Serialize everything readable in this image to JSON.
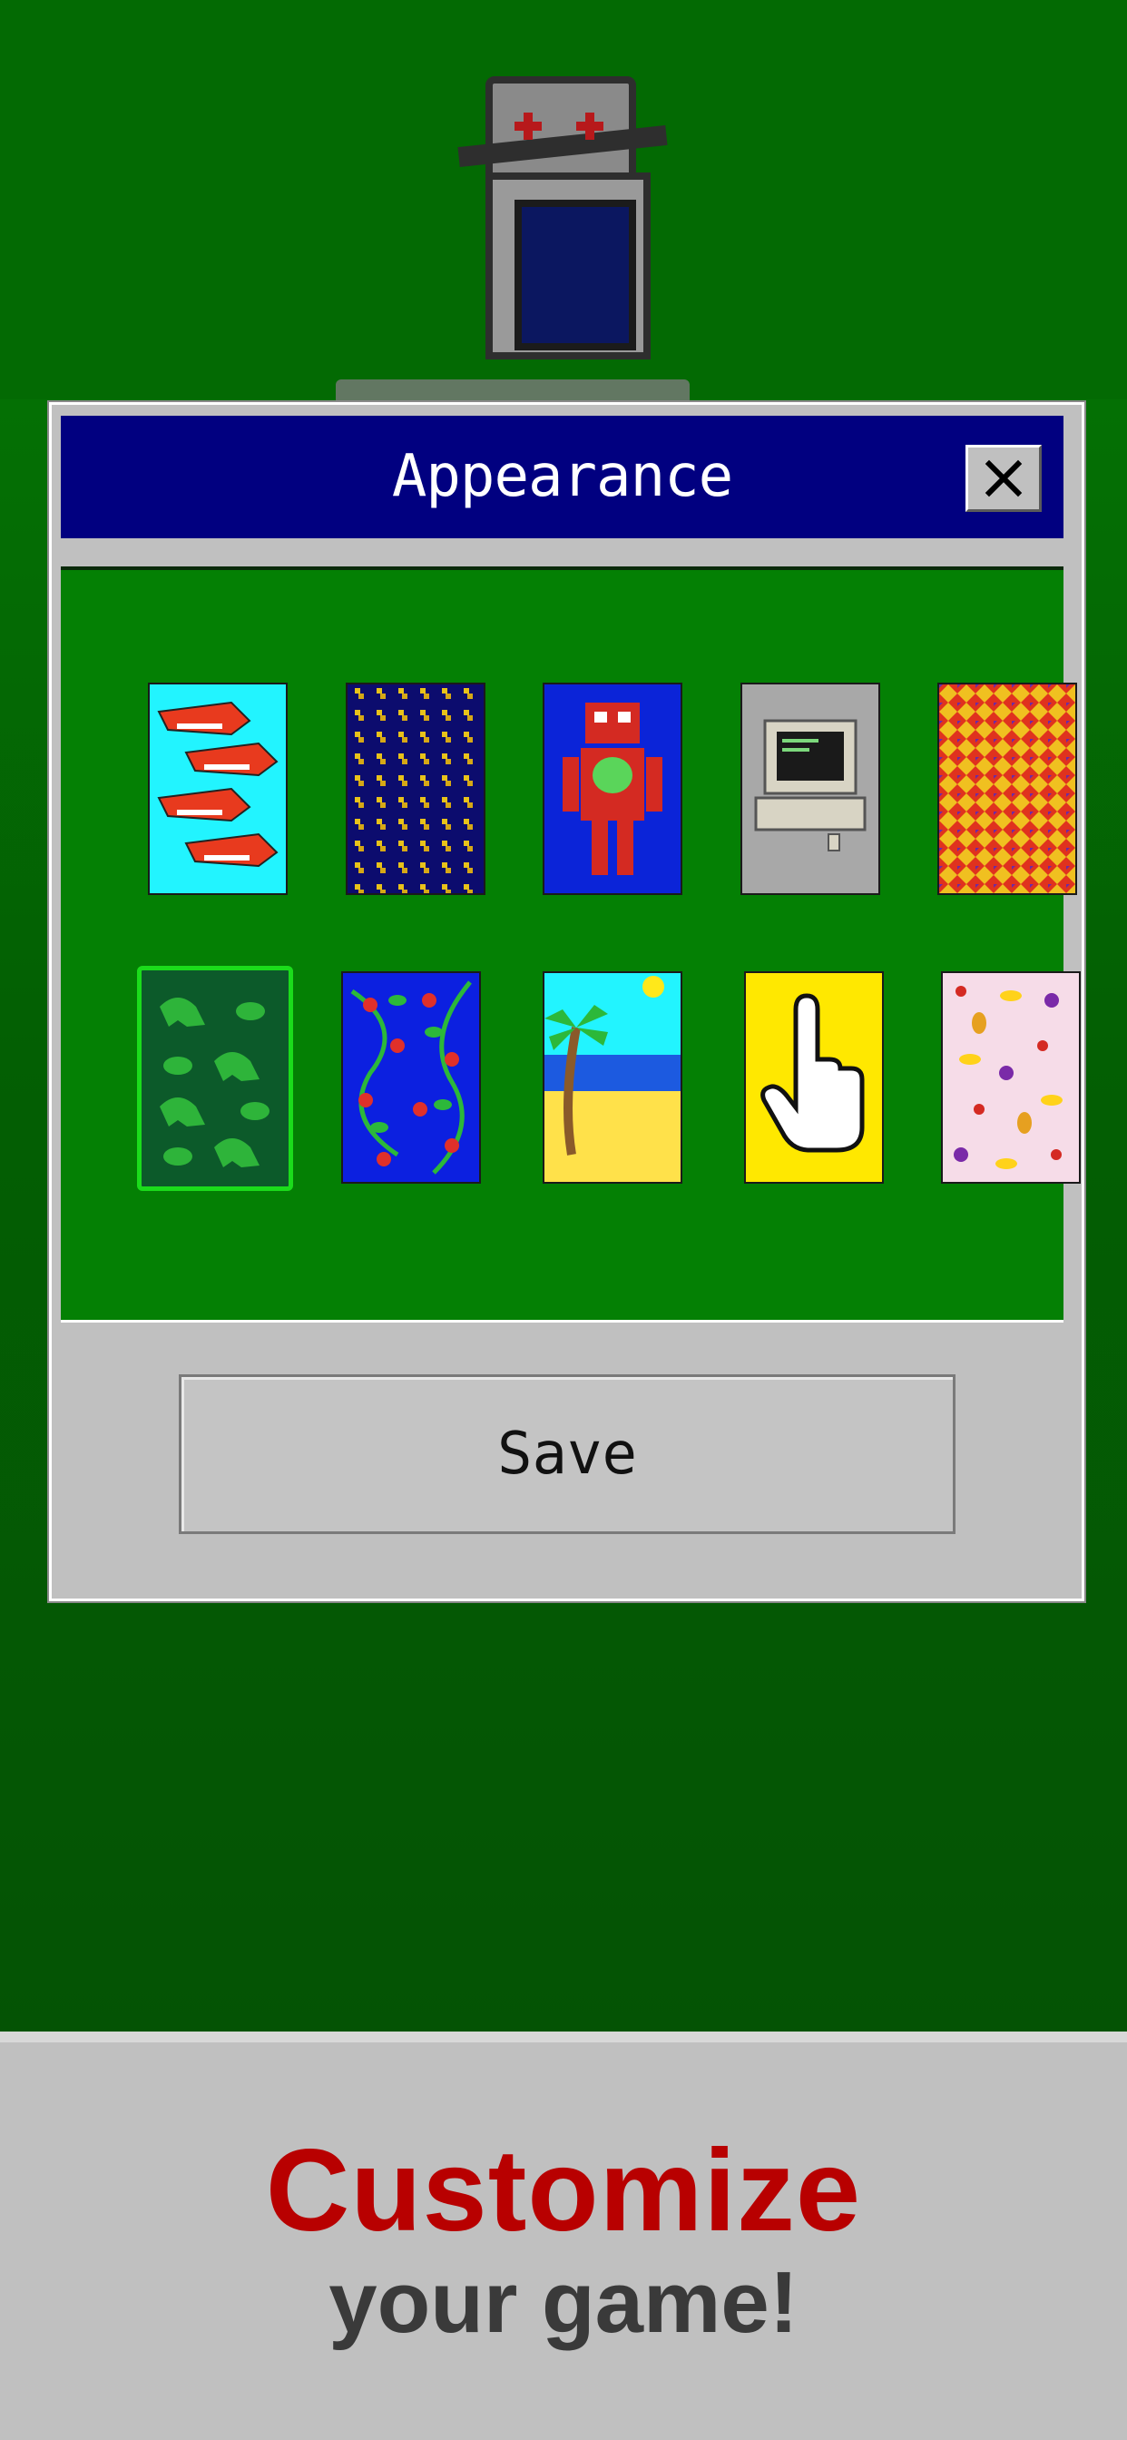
{
  "dialog": {
    "title": "Appearance",
    "save_label": "Save",
    "close_icon": "close-icon"
  },
  "card_backs": [
    {
      "name": "sharks",
      "selected": false
    },
    {
      "name": "gold-diamonds",
      "selected": false
    },
    {
      "name": "robot",
      "selected": false
    },
    {
      "name": "computer",
      "selected": false
    },
    {
      "name": "argyle",
      "selected": false
    },
    {
      "name": "dinosaurs",
      "selected": true
    },
    {
      "name": "strawberries",
      "selected": false
    },
    {
      "name": "beach",
      "selected": false
    },
    {
      "name": "pointer-hand",
      "selected": false
    },
    {
      "name": "fruits",
      "selected": false
    }
  ],
  "banner": {
    "line1": "Customize",
    "line2": "your game!"
  },
  "colors": {
    "titlebar": "#010080",
    "panel": "#048004",
    "selection": "#1bdc1b",
    "banner_accent": "#b80000"
  }
}
